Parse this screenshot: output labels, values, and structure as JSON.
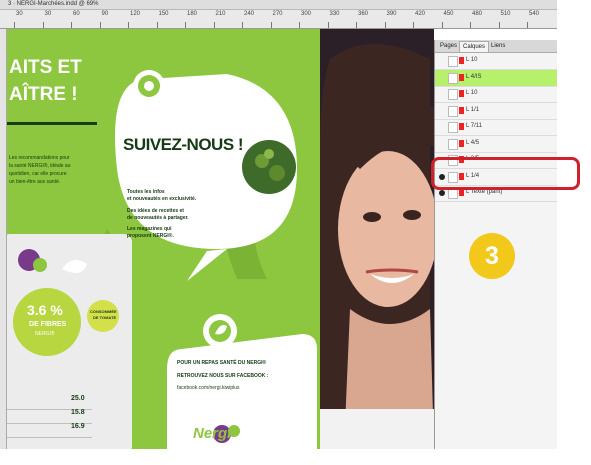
{
  "window": {
    "title": "3 · NERGI-Marchées.indd @ 69%"
  },
  "ruler": {
    "numbers": [
      "30",
      "30",
      "60",
      "90",
      "120",
      "150",
      "180",
      "210",
      "240",
      "270",
      "300",
      "330",
      "360",
      "390",
      "420",
      "450",
      "480",
      "510",
      "540"
    ]
  },
  "canvas": {
    "heading_left": [
      "AITS ET",
      "AÎTRE !"
    ],
    "body_left": [
      "Les recommandations pour",
      "la santé NERGI®, idéale au",
      "quotidien, car elle procure",
      "un bien-être aux santé."
    ],
    "bubble_title": "SUIVEZ-NOUS !",
    "bubble_lines": [
      "Toutes les infos",
      "et nouveautés en exclusivité.",
      "Des idées de recettes et",
      "de nouveautés à partager.",
      "Les magazines qui",
      "proposent NERGI®."
    ],
    "stat_big": "3.6 %",
    "stat_unit": "DE FIBRES",
    "stat_note": "NERGI®",
    "stat_side": [
      "CONSOMMÉE",
      "DE TOMATE"
    ],
    "bottom_lines": [
      "POUR UN REPAS SANTÉ DU NERGI®",
      "RETROUVEZ NOUS SUR FACEBOOK :",
      "facebook.com/nergi.kiwiplus"
    ],
    "table_values": [
      "25.0",
      "15.8",
      "16.9"
    ],
    "logo_text": "Nergi"
  },
  "panel": {
    "tabs": [
      "Pages",
      "Calques",
      "Liens"
    ],
    "layers": [
      {
        "name": "L 10",
        "visible": false,
        "highlight": false,
        "swatch": "#e22"
      },
      {
        "name": "L 4/IS",
        "visible": false,
        "highlight": true,
        "swatch": "#e22"
      },
      {
        "name": "L 10",
        "visible": false,
        "highlight": false,
        "swatch": "#e22"
      },
      {
        "name": "L 1/1",
        "visible": false,
        "highlight": false,
        "swatch": "#e22"
      },
      {
        "name": "L 7/11",
        "visible": false,
        "highlight": false,
        "swatch": "#e22"
      },
      {
        "name": "L 4/5",
        "visible": false,
        "highlight": false,
        "swatch": "#e22"
      },
      {
        "name": "L 3/5",
        "visible": false,
        "highlight": false,
        "swatch": "#e22"
      },
      {
        "name": "L 1/4",
        "visible": true,
        "highlight": false,
        "swatch": "#e22"
      },
      {
        "name": "L Texte (pant)",
        "visible": true,
        "highlight": false,
        "swatch": "#e22"
      }
    ]
  },
  "callout": {
    "number": "3"
  },
  "colors": {
    "brand_green": "#8dc63f",
    "highlight": "#b6f06c",
    "callout_red": "#d0202c",
    "badge_yellow": "#f2c81a"
  }
}
